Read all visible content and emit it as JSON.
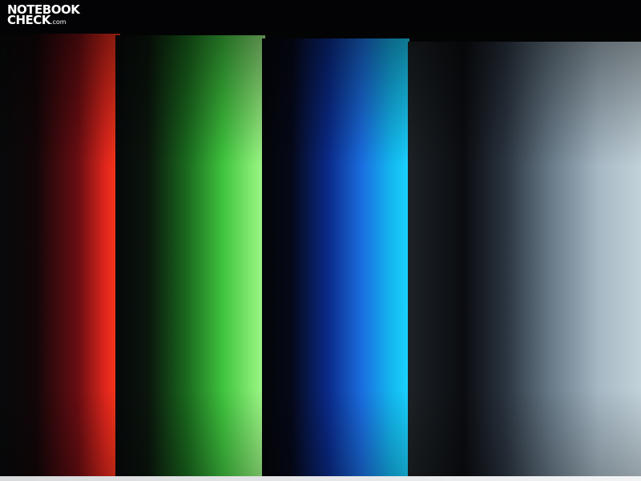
{
  "watermark": {
    "line1": "NOTEBOOK",
    "line2": "CHECK",
    "suffix": ".com"
  },
  "colors": {
    "red_band": "#ff3a1a",
    "green_band": "#a6f58e",
    "blue_band": "#1ad4ff",
    "gray_band": "#c2d2da",
    "background": "#030306"
  }
}
